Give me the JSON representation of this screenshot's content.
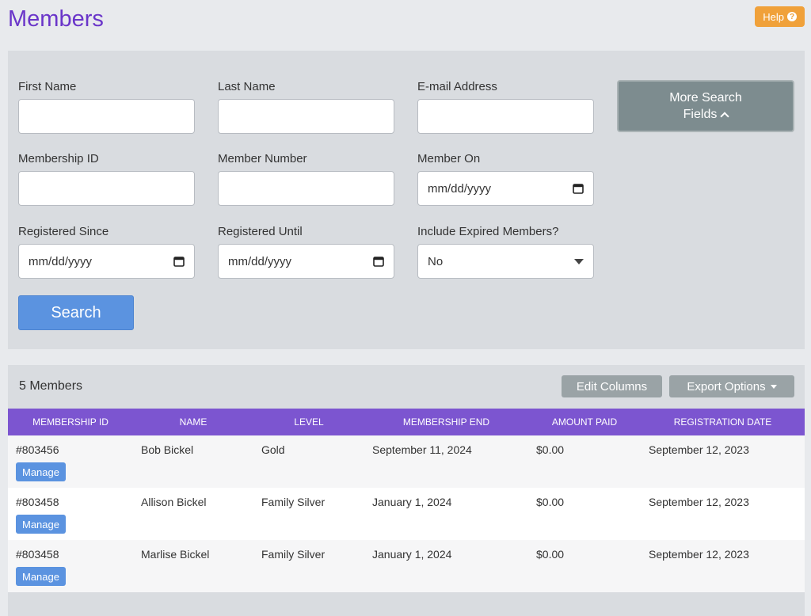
{
  "header": {
    "title": "Members",
    "help_label": "Help",
    "help_icon": "question-circle-icon"
  },
  "search": {
    "fields": {
      "first_name": {
        "label": "First Name",
        "value": ""
      },
      "last_name": {
        "label": "Last Name",
        "value": ""
      },
      "email": {
        "label": "E-mail Address",
        "value": ""
      },
      "membership_id": {
        "label": "Membership ID",
        "value": ""
      },
      "member_number": {
        "label": "Member Number",
        "value": ""
      },
      "member_on": {
        "label": "Member On",
        "value": "mm/dd/yyyy"
      },
      "registered_since": {
        "label": "Registered Since",
        "value": "mm/dd/yyyy"
      },
      "registered_until": {
        "label": "Registered Until",
        "value": "mm/dd/yyyy"
      },
      "include_expired": {
        "label": "Include Expired Members?",
        "value": "No"
      }
    },
    "more_label_line1": "More Search",
    "more_label_line2": "Fields",
    "search_label": "Search"
  },
  "results": {
    "count_label": "5 Members",
    "edit_columns_label": "Edit Columns",
    "export_label": "Export Options",
    "columns": [
      "MEMBERSHIP ID",
      "NAME",
      "LEVEL",
      "MEMBERSHIP END",
      "AMOUNT PAID",
      "REGISTRATION DATE"
    ],
    "manage_label": "Manage",
    "rows": [
      {
        "id": "#803456",
        "name": "Bob Bickel",
        "level": "Gold",
        "end": "September 11, 2024",
        "paid": "$0.00",
        "registered": "September 12, 2023"
      },
      {
        "id": "#803458",
        "name": "Allison Bickel",
        "level": "Family Silver",
        "end": "January 1, 2024",
        "paid": "$0.00",
        "registered": "September 12, 2023"
      },
      {
        "id": "#803458",
        "name": "Marlise Bickel",
        "level": "Family Silver",
        "end": "January 1, 2024",
        "paid": "$0.00",
        "registered": "September 12, 2023"
      }
    ]
  },
  "colors": {
    "title": "#6a35c9",
    "help": "#f0a13a",
    "primary": "#5b93e0",
    "table_header": "#7c55d0",
    "secondary_button": "#9aa3a6"
  }
}
